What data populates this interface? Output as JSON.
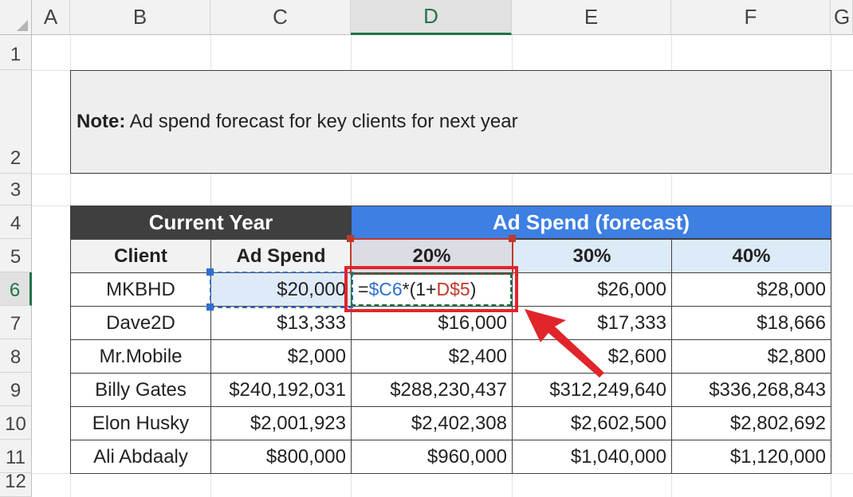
{
  "columns": [
    "A",
    "B",
    "C",
    "D",
    "E",
    "F",
    "G"
  ],
  "rows": [
    "1",
    "2",
    "3",
    "4",
    "5",
    "6",
    "7",
    "8",
    "9",
    "10",
    "11",
    "12"
  ],
  "note": {
    "bold": "Note:",
    "text": " Ad spend forecast for key clients for next year"
  },
  "headers": {
    "current_year": "Current Year",
    "forecast": "Ad Spend (forecast)"
  },
  "subheaders": {
    "client": "Client",
    "ad_spend": "Ad Spend",
    "pct1": "20%",
    "pct2": "30%",
    "pct3": "40%"
  },
  "formula": {
    "eq": "=",
    "ref1": "$C6",
    "mid": "*(1+",
    "ref2": "D$5",
    "end": ")"
  },
  "table": [
    {
      "client": "MKBHD",
      "spend": "$20,000",
      "d": "",
      "e": "$26,000",
      "f": "$28,000"
    },
    {
      "client": "Dave2D",
      "spend": "$13,333",
      "d": "$16,000",
      "e": "$17,333",
      "f": "$18,666"
    },
    {
      "client": "Mr.Mobile",
      "spend": "$2,000",
      "d": "$2,400",
      "e": "$2,600",
      "f": "$2,800"
    },
    {
      "client": "Billy Gates",
      "spend": "$240,192,031",
      "d": "$288,230,437",
      "e": "$312,249,640",
      "f": "$336,268,843"
    },
    {
      "client": "Elon Husky",
      "spend": "$2,001,923",
      "d": "$2,402,308",
      "e": "$2,602,500",
      "f": "$2,802,692"
    },
    {
      "client": "Ali Abdaaly",
      "spend": "$800,000",
      "d": "$960,000",
      "e": "$1,040,000",
      "f": "$1,120,000"
    }
  ],
  "colors": {
    "accent_green": "#217346",
    "header_dark": "#3f3f3f",
    "header_blue": "#3d7fe3",
    "highlight_red": "#e0252b",
    "ref_blue": "#2f6fcf",
    "ref_red": "#c0392b"
  }
}
